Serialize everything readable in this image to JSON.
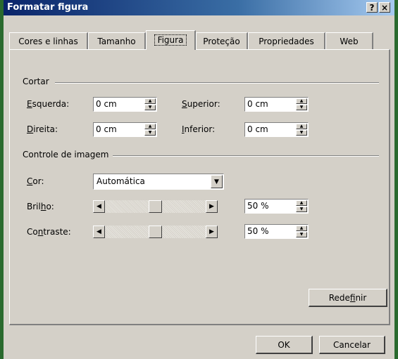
{
  "window": {
    "title": "Formatar figura",
    "help_label": "?",
    "close_label": "×"
  },
  "tabs": [
    {
      "label": "Cores e linhas",
      "active": false
    },
    {
      "label": "Tamanho",
      "active": false
    },
    {
      "label": "Figura",
      "active": true
    },
    {
      "label": "Proteção",
      "active": false
    },
    {
      "label": "Propriedades",
      "active": false
    },
    {
      "label": "Web",
      "active": false
    }
  ],
  "crop": {
    "group_label": "Cortar",
    "left_label_key": "E",
    "left_label_rest": "squerda:",
    "left_value": "0 cm",
    "right_label_key": "D",
    "right_label_rest": "ireita:",
    "right_value": "0 cm",
    "top_label_key": "S",
    "top_label_rest": "uperior:",
    "top_value": "0 cm",
    "bottom_label_key": "I",
    "bottom_label_rest": "nferior:",
    "bottom_value": "0 cm"
  },
  "image_control": {
    "group_label": "Controle de imagem",
    "color_label_key": "C",
    "color_label_rest": "or:",
    "color_value": "Automática",
    "brightness_label_pre": "Bril",
    "brightness_label_key": "h",
    "brightness_label_post": "o:",
    "brightness_value": "50 %",
    "brightness_level": 0.5,
    "contrast_label_pre": "Co",
    "contrast_label_key": "n",
    "contrast_label_post": "traste:",
    "contrast_value": "50 %",
    "contrast_level": 0.5
  },
  "buttons": {
    "reset_pre": "Rede",
    "reset_key": "f",
    "reset_post": "inir",
    "ok_label": "OK",
    "cancel_label": "Cancelar"
  }
}
